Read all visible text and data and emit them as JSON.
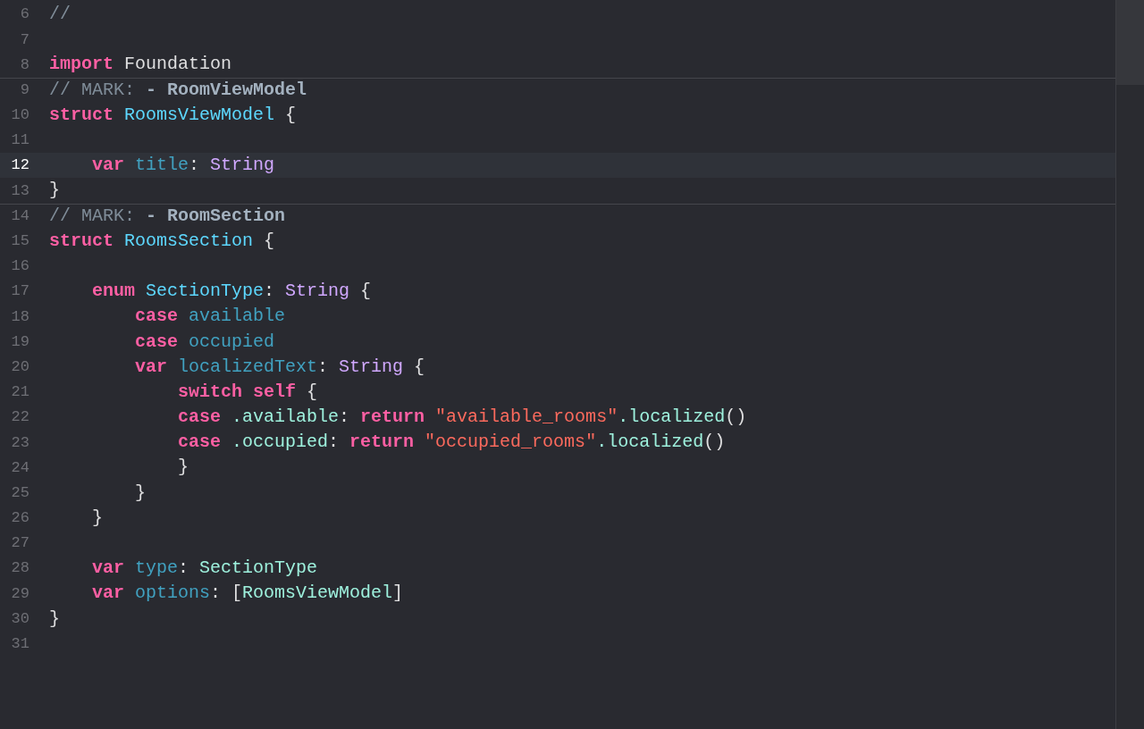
{
  "editor": {
    "lines": [
      {
        "number": "6",
        "current": false,
        "separator": false,
        "tokens": [
          {
            "kind": "comment",
            "text": "//"
          }
        ]
      },
      {
        "number": "7",
        "current": false,
        "separator": false
      },
      {
        "number": "8",
        "current": false,
        "separator": false,
        "tokens": [
          {
            "kind": "keyword",
            "text": "import"
          },
          {
            "kind": "plain",
            "text": " Foundation"
          }
        ]
      },
      {
        "number": "9",
        "current": false,
        "separator": true,
        "tokens": [
          {
            "kind": "comment",
            "text": "// MARK: "
          },
          {
            "kind": "mark",
            "text": "- RoomViewModel"
          }
        ]
      },
      {
        "number": "10",
        "current": false,
        "separator": false,
        "tokens": [
          {
            "kind": "keyword",
            "text": "struct"
          },
          {
            "kind": "declaration",
            "text": " RoomsViewModel"
          },
          {
            "kind": "plain",
            "text": " {"
          }
        ]
      },
      {
        "number": "11",
        "current": false,
        "separator": false
      },
      {
        "number": "12",
        "current": true,
        "separator": false,
        "tokens": [
          {
            "kind": "keyword",
            "text": "    var"
          },
          {
            "kind": "property",
            "text": " title"
          },
          {
            "kind": "plain",
            "text": ": "
          },
          {
            "kind": "type",
            "text": "String"
          }
        ]
      },
      {
        "number": "13",
        "current": false,
        "separator": false,
        "tokens": [
          {
            "kind": "plain",
            "text": "}"
          }
        ]
      },
      {
        "number": "14",
        "current": false,
        "separator": true,
        "tokens": [
          {
            "kind": "comment",
            "text": "// MARK: "
          },
          {
            "kind": "mark",
            "text": "- RoomSection"
          }
        ]
      },
      {
        "number": "15",
        "current": false,
        "separator": false,
        "tokens": [
          {
            "kind": "keyword",
            "text": "struct"
          },
          {
            "kind": "declaration",
            "text": " RoomsSection"
          },
          {
            "kind": "plain",
            "text": " {"
          }
        ]
      },
      {
        "number": "16",
        "current": false,
        "separator": false
      },
      {
        "number": "17",
        "current": false,
        "separator": false,
        "tokens": [
          {
            "kind": "keyword",
            "text": "    enum"
          },
          {
            "kind": "declaration",
            "text": " SectionType"
          },
          {
            "kind": "plain",
            "text": ": "
          },
          {
            "kind": "type",
            "text": "String"
          },
          {
            "kind": "plain",
            "text": " {"
          }
        ]
      },
      {
        "number": "18",
        "current": false,
        "separator": false,
        "tokens": [
          {
            "kind": "keyword",
            "text": "        case"
          },
          {
            "kind": "property",
            "text": " available"
          }
        ]
      },
      {
        "number": "19",
        "current": false,
        "separator": false,
        "tokens": [
          {
            "kind": "keyword",
            "text": "        case"
          },
          {
            "kind": "property",
            "text": " occupied"
          }
        ]
      },
      {
        "number": "20",
        "current": false,
        "separator": false,
        "tokens": [
          {
            "kind": "keyword",
            "text": "        var"
          },
          {
            "kind": "property",
            "text": " localizedText"
          },
          {
            "kind": "plain",
            "text": ": "
          },
          {
            "kind": "type",
            "text": "String"
          },
          {
            "kind": "plain",
            "text": " {"
          }
        ]
      },
      {
        "number": "21",
        "current": false,
        "separator": false,
        "tokens": [
          {
            "kind": "keyword",
            "text": "            switch self"
          },
          {
            "kind": "plain",
            "text": " {"
          }
        ]
      },
      {
        "number": "22",
        "current": false,
        "separator": false,
        "tokens": [
          {
            "kind": "keyword",
            "text": "            case"
          },
          {
            "kind": "member",
            "text": " .available"
          },
          {
            "kind": "plain",
            "text": ": "
          },
          {
            "kind": "keyword",
            "text": "return"
          },
          {
            "kind": "string",
            "text": " \"available_rooms\""
          },
          {
            "kind": "member",
            "text": ".localized"
          },
          {
            "kind": "plain",
            "text": "()"
          }
        ]
      },
      {
        "number": "23",
        "current": false,
        "separator": false,
        "tokens": [
          {
            "kind": "keyword",
            "text": "            case"
          },
          {
            "kind": "member",
            "text": " .occupied"
          },
          {
            "kind": "plain",
            "text": ": "
          },
          {
            "kind": "keyword",
            "text": "return"
          },
          {
            "kind": "string",
            "text": " \"occupied_rooms\""
          },
          {
            "kind": "member",
            "text": ".localized"
          },
          {
            "kind": "plain",
            "text": "()"
          }
        ]
      },
      {
        "number": "24",
        "current": false,
        "separator": false,
        "tokens": [
          {
            "kind": "plain",
            "text": "            }"
          }
        ]
      },
      {
        "number": "25",
        "current": false,
        "separator": false,
        "tokens": [
          {
            "kind": "plain",
            "text": "        }"
          }
        ]
      },
      {
        "number": "26",
        "current": false,
        "separator": false,
        "tokens": [
          {
            "kind": "plain",
            "text": "    }"
          }
        ]
      },
      {
        "number": "27",
        "current": false,
        "separator": false
      },
      {
        "number": "28",
        "current": false,
        "separator": false,
        "tokens": [
          {
            "kind": "keyword",
            "text": "    var"
          },
          {
            "kind": "property",
            "text": " type"
          },
          {
            "kind": "plain",
            "text": ": "
          },
          {
            "kind": "member",
            "text": "SectionType"
          }
        ]
      },
      {
        "number": "29",
        "current": false,
        "separator": false,
        "tokens": [
          {
            "kind": "keyword",
            "text": "    var"
          },
          {
            "kind": "property",
            "text": " options"
          },
          {
            "kind": "plain",
            "text": ": ["
          },
          {
            "kind": "member",
            "text": "RoomsViewModel"
          },
          {
            "kind": "plain",
            "text": "]"
          }
        ]
      },
      {
        "number": "30",
        "current": false,
        "separator": false,
        "tokens": [
          {
            "kind": "plain",
            "text": "}"
          }
        ]
      },
      {
        "number": "31",
        "current": false,
        "separator": false
      }
    ]
  }
}
